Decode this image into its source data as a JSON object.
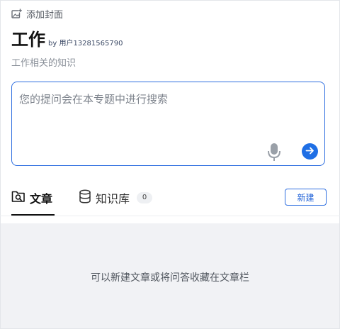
{
  "header": {
    "add_cover_label": "添加封面",
    "add_cover_icon": "image-add-icon"
  },
  "topic": {
    "title": "工作",
    "byline": "by 用户13281565790",
    "description": "工作相关的知识"
  },
  "search": {
    "placeholder": "您的提问会在本专题中进行搜索",
    "value": "",
    "mic_icon": "microphone-icon",
    "send_icon": "arrow-right-circle-icon"
  },
  "tabs": [
    {
      "label": "文章",
      "icon": "folder-search-icon",
      "active": true
    },
    {
      "label": "知识库",
      "icon": "database-icon",
      "count": "0",
      "active": false
    }
  ],
  "actions": {
    "new_label": "新建"
  },
  "empty_state": {
    "message": "可以新建文章或将问答收藏在文章栏"
  },
  "colors": {
    "accent": "#2f6fe0",
    "send_button": "#1f6fe5",
    "empty_background": "#f1f2f5"
  }
}
